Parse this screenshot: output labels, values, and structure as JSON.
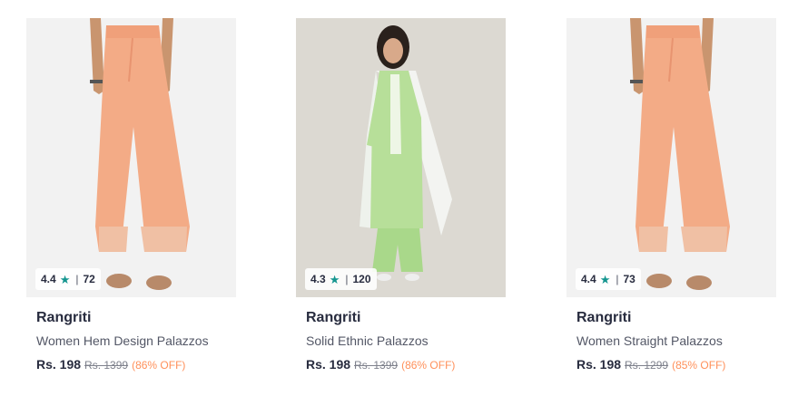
{
  "products": [
    {
      "brand": "Rangriti",
      "title": "Women Hem Design Palazzos",
      "rating": "4.4",
      "reviews": "72",
      "price": "Rs. 198",
      "mrp": "Rs. 1399",
      "discount": "(86% OFF)",
      "image": "peach-palazzo-pants"
    },
    {
      "brand": "Rangriti",
      "title": "Solid Ethnic Palazzos",
      "rating": "4.3",
      "reviews": "120",
      "price": "Rs. 198",
      "mrp": "Rs. 1399",
      "discount": "(86% OFF)",
      "image": "green-kurta-set-model"
    },
    {
      "brand": "Rangriti",
      "title": "Women Straight Palazzos",
      "rating": "4.4",
      "reviews": "73",
      "price": "Rs. 198",
      "mrp": "Rs. 1299",
      "discount": "(85% OFF)",
      "image": "peach-palazzo-pants"
    }
  ],
  "colors": {
    "star": "#14958f",
    "discount": "#ff905a",
    "brand_text": "#282c3f"
  }
}
